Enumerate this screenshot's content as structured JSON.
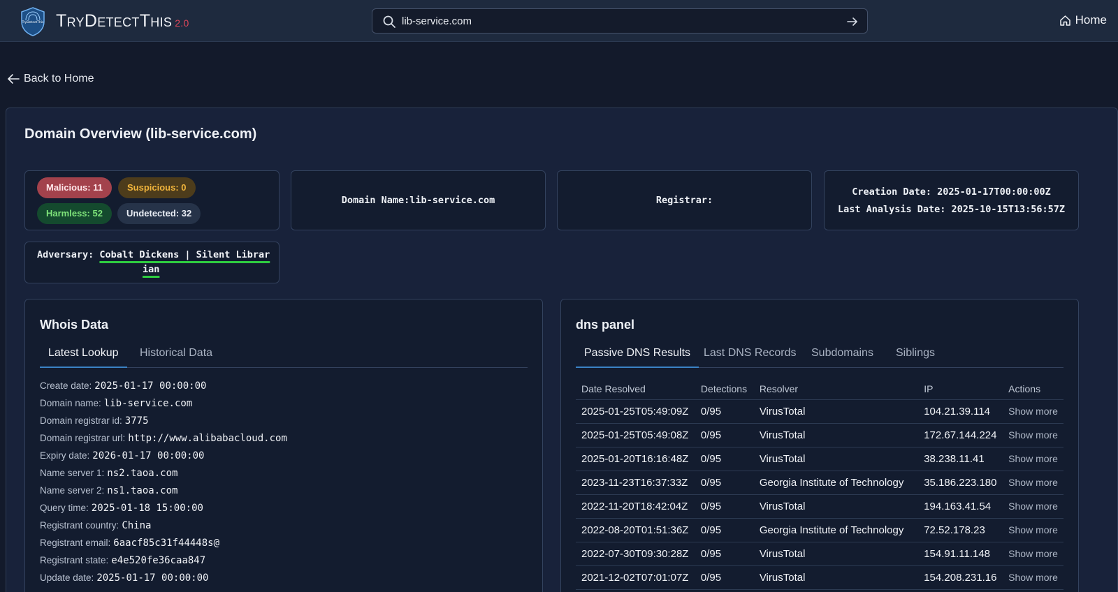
{
  "header": {
    "brand": "TryDetectThis",
    "version": "2.0",
    "logo_text": "TryDetectThis",
    "search_value": "lib-service.com",
    "home_label": "Home"
  },
  "back_label": "Back to Home",
  "overview": {
    "title": "Domain Overview (lib-service.com)",
    "badges": {
      "malicious": "Malicious: 11",
      "suspicious": "Suspicious: 0",
      "harmless": "Harmless: 52",
      "undetected": "Undetected: 32"
    },
    "domain_name": "Domain Name:lib-service.com",
    "registrar": "Registrar:",
    "creation_date": "Creation Date: 2025-01-17T00:00:00Z",
    "last_analysis": "Last Analysis Date: 2025-10-15T13:56:57Z",
    "adversary_label": "Adversary:",
    "adversary_line1": "Cobalt Dickens | Silent Librar",
    "adversary_line2": "ian"
  },
  "whois": {
    "title": "Whois Data",
    "tabs": [
      "Latest Lookup",
      "Historical Data"
    ],
    "rows": [
      {
        "label": "Create date:",
        "value": "2025-01-17 00:00:00"
      },
      {
        "label": "Domain name:",
        "value": "lib-service.com"
      },
      {
        "label": "Domain registrar id:",
        "value": "3775"
      },
      {
        "label": "Domain registrar url:",
        "value": "http://www.alibabacloud.com"
      },
      {
        "label": "Expiry date:",
        "value": "2026-01-17 00:00:00"
      },
      {
        "label": "Name server 1:",
        "value": "ns2.taoa.com"
      },
      {
        "label": "Name server 2:",
        "value": "ns1.taoa.com"
      },
      {
        "label": "Query time:",
        "value": "2025-01-18 15:00:00"
      },
      {
        "label": "Registrant country:",
        "value": "China"
      },
      {
        "label": "Registrant email:",
        "value": "6aacf85c31f44448s@"
      },
      {
        "label": "Registrant state:",
        "value": "e4e520fe36caa847"
      },
      {
        "label": "Update date:",
        "value": "2025-01-17 00:00:00"
      }
    ]
  },
  "dns": {
    "title": "dns panel",
    "tabs": [
      "Passive DNS Results",
      "Last DNS Records",
      "Subdomains",
      "Siblings"
    ],
    "columns": [
      "Date Resolved",
      "Detections",
      "Resolver",
      "IP",
      "Actions"
    ],
    "rows": [
      [
        "2025-01-25T05:49:09Z",
        "0/95",
        "VirusTotal",
        "104.21.39.114",
        "Show more"
      ],
      [
        "2025-01-25T05:49:08Z",
        "0/95",
        "VirusTotal",
        "172.67.144.224",
        "Show more"
      ],
      [
        "2025-01-20T16:16:48Z",
        "0/95",
        "VirusTotal",
        "38.238.11.41",
        "Show more"
      ],
      [
        "2023-11-23T16:37:33Z",
        "0/95",
        "Georgia Institute of Technology",
        "35.186.223.180",
        "Show more"
      ],
      [
        "2022-11-20T18:42:04Z",
        "0/95",
        "VirusTotal",
        "194.163.41.54",
        "Show more"
      ],
      [
        "2022-08-20T01:51:36Z",
        "0/95",
        "Georgia Institute of Technology",
        "72.52.178.23",
        "Show more"
      ],
      [
        "2022-07-30T09:30:28Z",
        "0/95",
        "VirusTotal",
        "154.91.11.148",
        "Show more"
      ],
      [
        "2021-12-02T07:01:07Z",
        "0/95",
        "VirusTotal",
        "154.208.231.16",
        "Show more"
      ]
    ]
  }
}
